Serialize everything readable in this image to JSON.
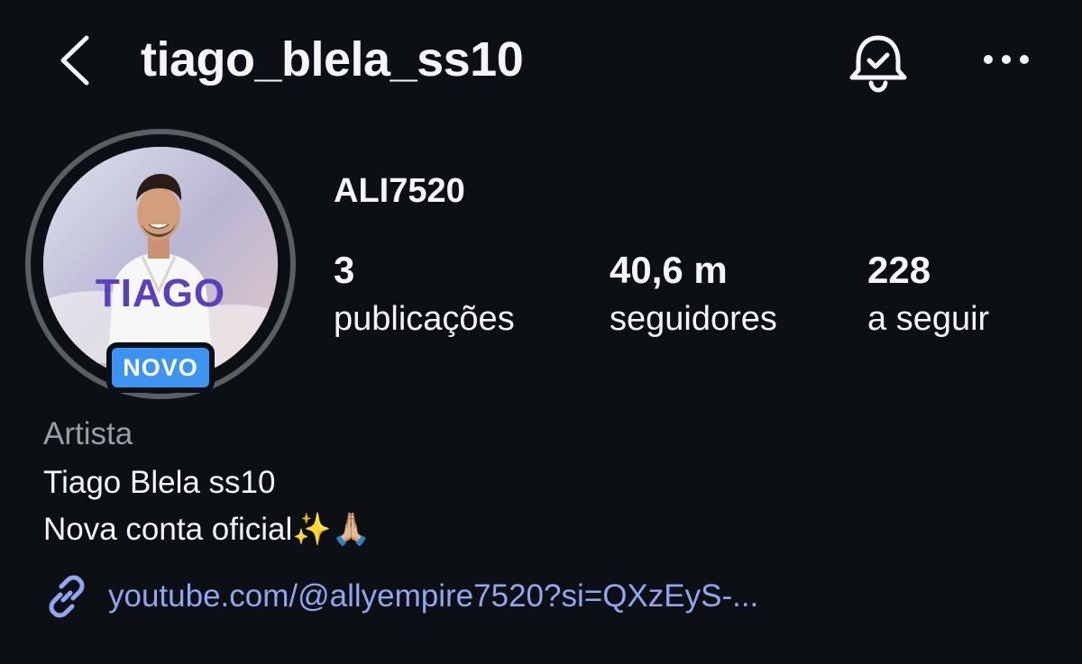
{
  "header": {
    "username": "tiago_blela_ss10",
    "back_icon": "chevron-left-icon",
    "notifications_icon": "bell-check-icon",
    "more_icon": "more-horizontal-icon"
  },
  "profile": {
    "avatar_text": "TIAGO",
    "badge": "NOVO",
    "display_name": "ALI7520",
    "stats": {
      "posts": {
        "value": "3",
        "label": "publicações"
      },
      "followers": {
        "value": "40,6 m",
        "label": "seguidores"
      },
      "following": {
        "value": "228",
        "label": "a seguir"
      }
    },
    "category": "Artista",
    "bio_line_1": "Tiago Blela ss10",
    "bio_line_2": "Nova conta oficial✨🙏🏼",
    "link_icon": "link-icon",
    "link_text": "youtube.com/@allyempire7520?si=QXzEyS-..."
  },
  "colors": {
    "background": "#0c0f14",
    "text": "#f5f5f7",
    "muted": "#9a9da5",
    "link": "#8fa6f0",
    "badge": "#3d94f0",
    "ring": "#5b5e64"
  }
}
